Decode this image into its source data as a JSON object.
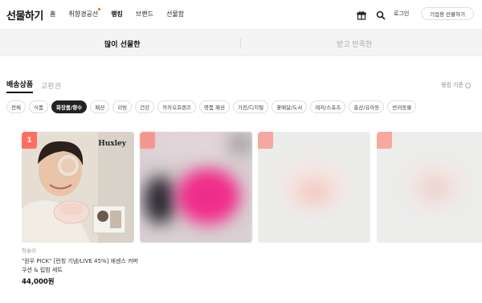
{
  "header": {
    "logo": "선물하기",
    "nav": [
      "홈",
      "취향경공선",
      "랭킹",
      "브랜드",
      "선물함"
    ],
    "active_nav": "랭킹",
    "login": "로그인",
    "business_button": "기업용 선물하기",
    "icons": [
      "gift-box-icon",
      "search-icon"
    ]
  },
  "big_tabs": {
    "left": "많이 선물한",
    "right": "받고 만족한"
  },
  "sub_tabs": {
    "delivery": "배송상품",
    "voucher": "교환권"
  },
  "sort_label": "랭킹 기준",
  "chips": [
    "전체",
    "식품",
    "화장품/향수",
    "패션",
    "리빙",
    "건강",
    "카카오프렌즈",
    "명품 패션",
    "가전/디지털",
    "꽃배달/도서",
    "레저/스포츠",
    "출산/유아동",
    "반려동물"
  ],
  "active_chip": "화장품/향수",
  "products": [
    {
      "rank": "1",
      "brand_tag": "Huxley",
      "store": "헉슬리",
      "name": "\"원우 PICK\" [런칭 기념/LIVE 45%] 에센스 커버 쿠션 & 립밤 세트",
      "price": "44,000원"
    },
    {
      "rank": ""
    },
    {
      "rank": ""
    },
    {
      "rank": ""
    }
  ],
  "colors": {
    "rank_badge": "#ff6f61",
    "active_chip_bg": "#222222",
    "nav_dot": "#ff5a1f"
  }
}
